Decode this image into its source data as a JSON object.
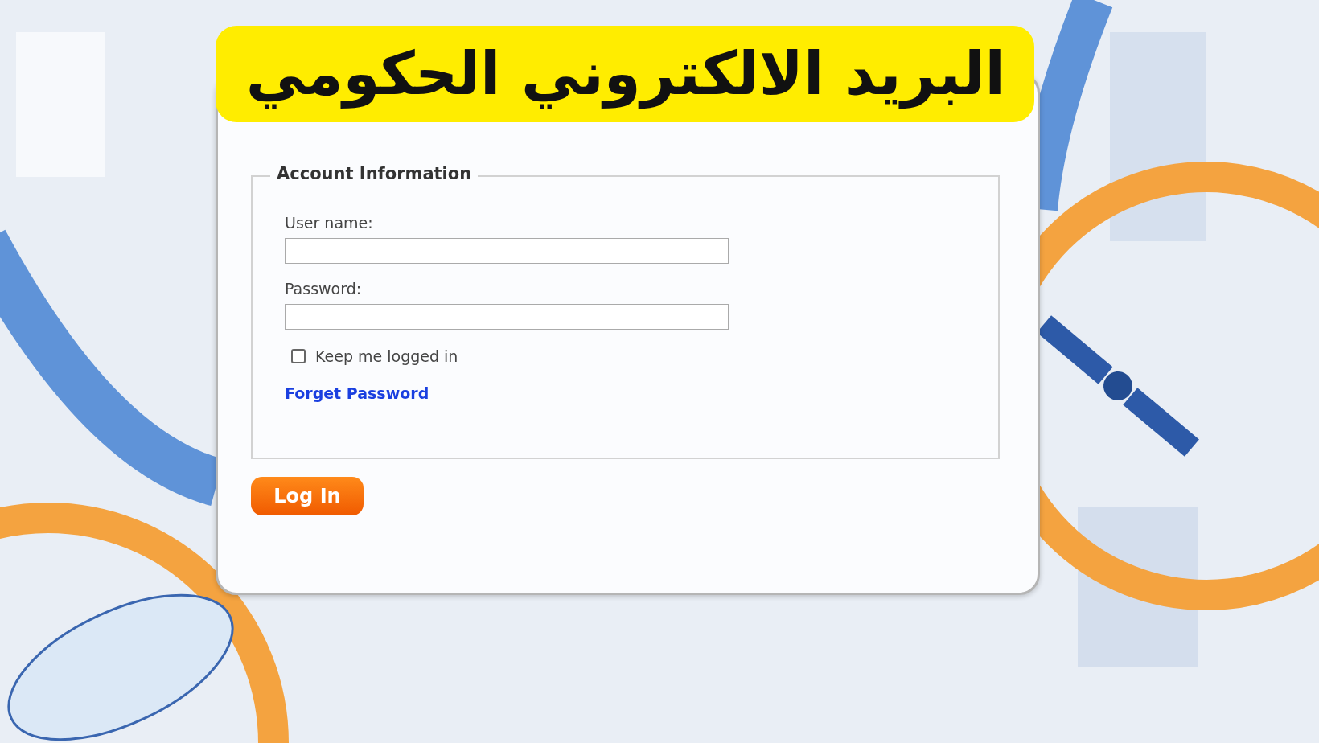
{
  "banner": {
    "title": "البريد الالكتروني الحكومي"
  },
  "form": {
    "legend": "Account Information",
    "fields": [
      {
        "label": "User name:"
      },
      {
        "label": "Password:"
      }
    ],
    "keep_logged_in": {
      "label": "Keep me logged in",
      "checked": false
    },
    "forgot_link": "Forget Password",
    "submit": "Log In"
  }
}
